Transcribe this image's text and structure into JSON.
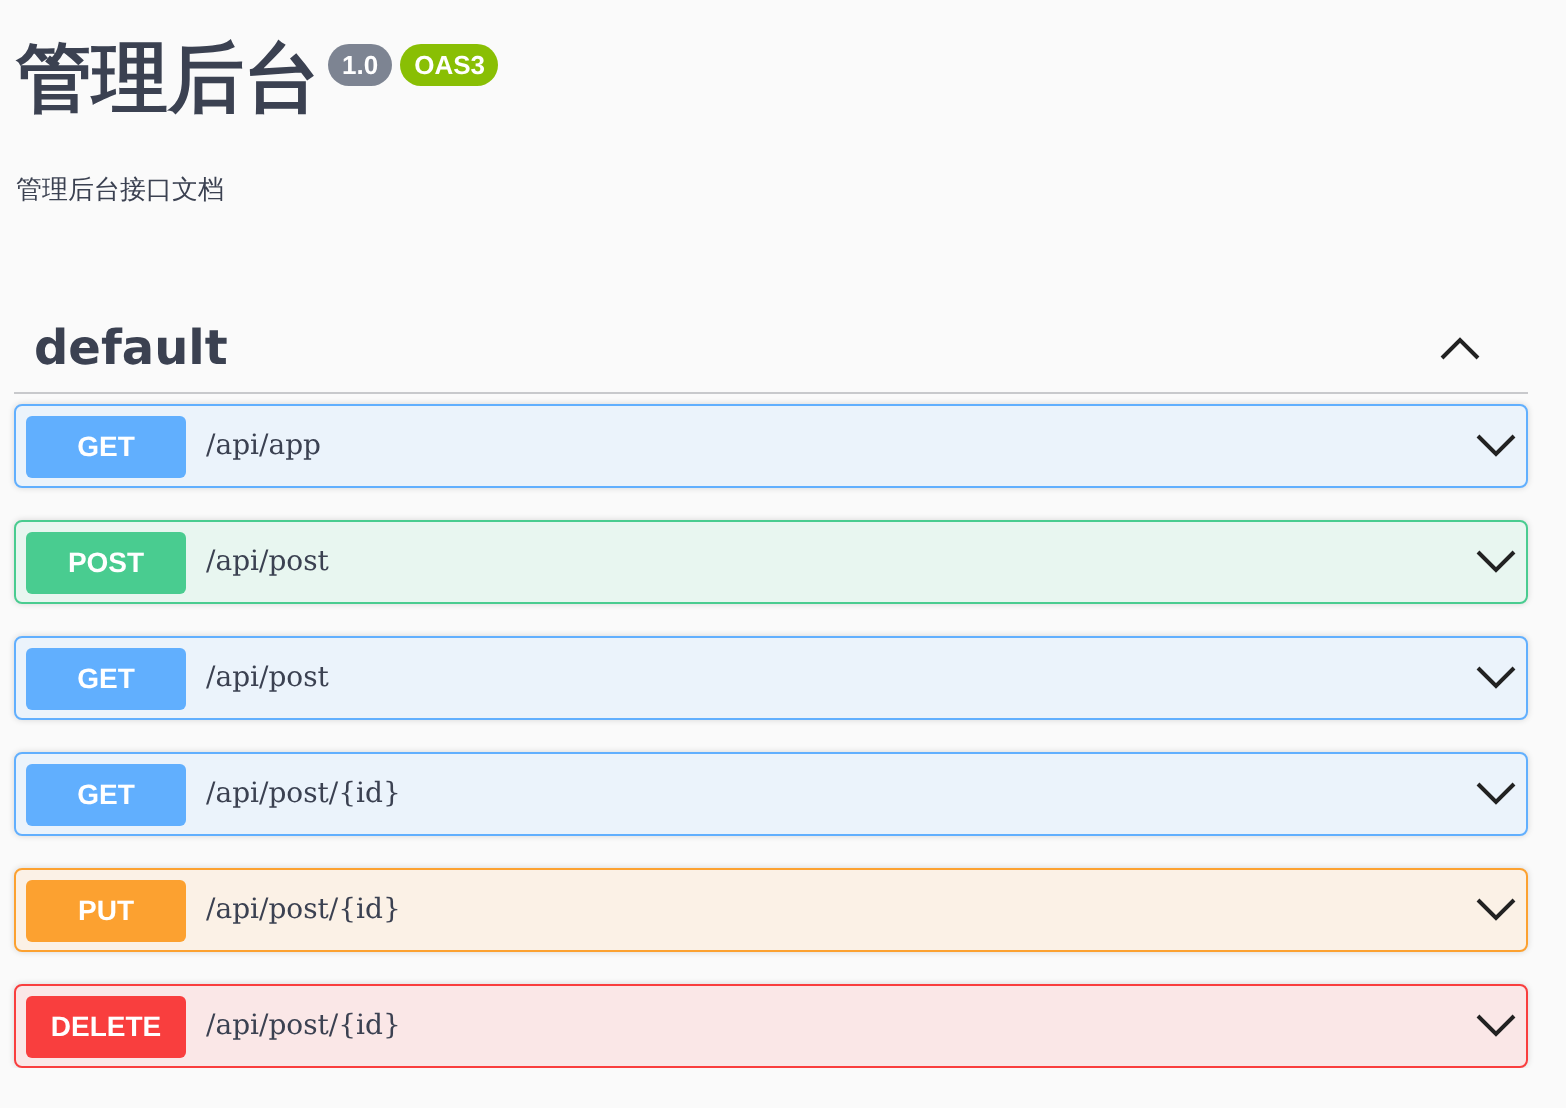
{
  "info": {
    "title": "管理后台",
    "version": "1.0",
    "spec": "OAS3",
    "description": "管理后台接口文档"
  },
  "section": {
    "name": "default",
    "expanded": true,
    "operations": [
      {
        "method": "GET",
        "kind": "get",
        "path": "/api/app",
        "expanded": false
      },
      {
        "method": "POST",
        "kind": "post",
        "path": "/api/post",
        "expanded": false
      },
      {
        "method": "GET",
        "kind": "get",
        "path": "/api/post",
        "expanded": false
      },
      {
        "method": "GET",
        "kind": "get",
        "path": "/api/post/{id}",
        "expanded": false
      },
      {
        "method": "PUT",
        "kind": "put",
        "path": "/api/post/{id}",
        "expanded": false
      },
      {
        "method": "DELETE",
        "kind": "delete",
        "path": "/api/post/{id}",
        "expanded": false
      }
    ]
  }
}
